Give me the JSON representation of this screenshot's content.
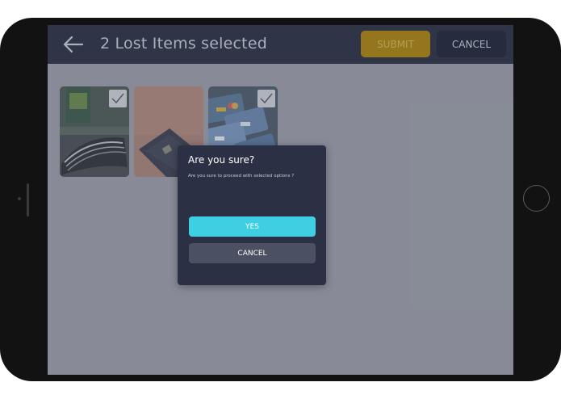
{
  "header": {
    "title": "2 Lost Items selected",
    "submit_label": "SUBMIT",
    "cancel_label": "CANCEL",
    "back_icon": "arrow-left-icon"
  },
  "items": [
    {
      "name": "wallet-on-ground",
      "selected": true
    },
    {
      "name": "passport",
      "selected": false
    },
    {
      "name": "credit-cards",
      "selected": true
    }
  ],
  "dialog": {
    "title": "Are you sure?",
    "message": "Are you sure to proceed with selected options ?",
    "yes_label": "YES",
    "cancel_label": "CANCEL"
  },
  "colors": {
    "header_bg": "#2f3447",
    "submit_bg": "#94761c",
    "yes_bg": "#3ecfe3",
    "dialog_bg": "#2b3044"
  }
}
